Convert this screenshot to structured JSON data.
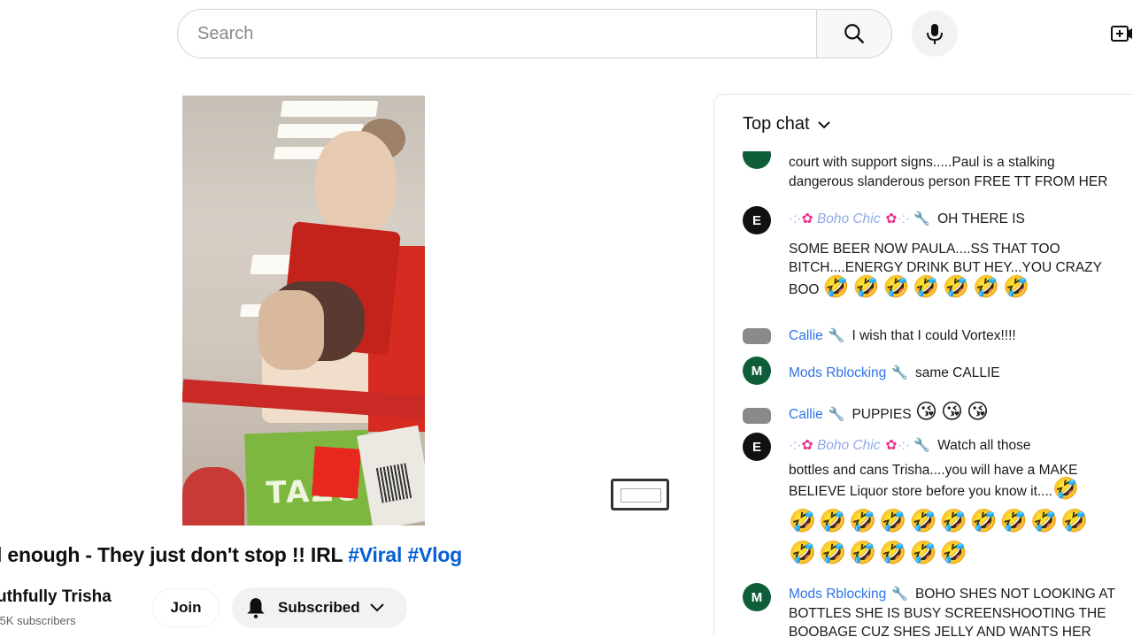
{
  "header": {
    "search_placeholder": "Search",
    "search_icon": "search-icon",
    "mic_icon": "mic-icon",
    "create_icon": "create-video-icon"
  },
  "video": {
    "package_text": "TAZO",
    "title_prefix": "l enough - They just don't stop !! IRL ",
    "hashtag_1": "#Viral",
    "hashtag_2": "#Vlog"
  },
  "channel": {
    "name": "uthfully Trisha",
    "subscribers": ".5K subscribers",
    "join_label": "Join",
    "subscribed_label": "Subscribed"
  },
  "chat": {
    "mode_label": "Top chat",
    "messages": [
      {
        "line1": "court with support signs.....Paul is a stalking",
        "line2": "dangerous slanderous person FREE TT FROM HER"
      },
      {
        "avatar_letter": "E",
        "author": "Boho Chic",
        "line1": "OH THERE IS",
        "line2": "SOME BEER NOW PAULA....SS THAT TOO",
        "line3": "BITCH....ENERGY DRINK BUT HEY...YOU CRAZY",
        "line4_text": "BOO",
        "emojis": "🤣🤣🤣🤣🤣🤣🤣"
      },
      {
        "author": "Callie",
        "text": "I wish that I could Vortex!!!!"
      },
      {
        "avatar_letter": "M",
        "author": "Mods Rblocking",
        "text": "same CALLIE"
      },
      {
        "author": "Callie",
        "text": "PUPPIES",
        "emojis": "😘😘😘"
      },
      {
        "avatar_letter": "E",
        "author": "Boho Chic",
        "line1": "Watch all those",
        "line2": "bottles and cans Trisha....you will have a MAKE",
        "line3": "BELIEVE Liquor store before you know it....",
        "line3_emoji": "🤣",
        "emoji_row1": "🤣🤣🤣🤣🤣🤣🤣🤣🤣🤣",
        "emoji_row2": "🤣🤣🤣🤣🤣🤣"
      },
      {
        "avatar_letter": "M",
        "author": "Mods Rblocking",
        "line1": "BOHO SHES NOT LOOKING AT",
        "line2": "BOTTLES SHE IS BUSY SCREENSHOOTING THE",
        "line3": "BOOBAGE CUZ SHES JELLY AND WANTS HER"
      }
    ]
  },
  "colors": {
    "link_blue": "#065fd4",
    "author_blue": "#2f74e8",
    "avatar_green": "#0f5e3b"
  }
}
